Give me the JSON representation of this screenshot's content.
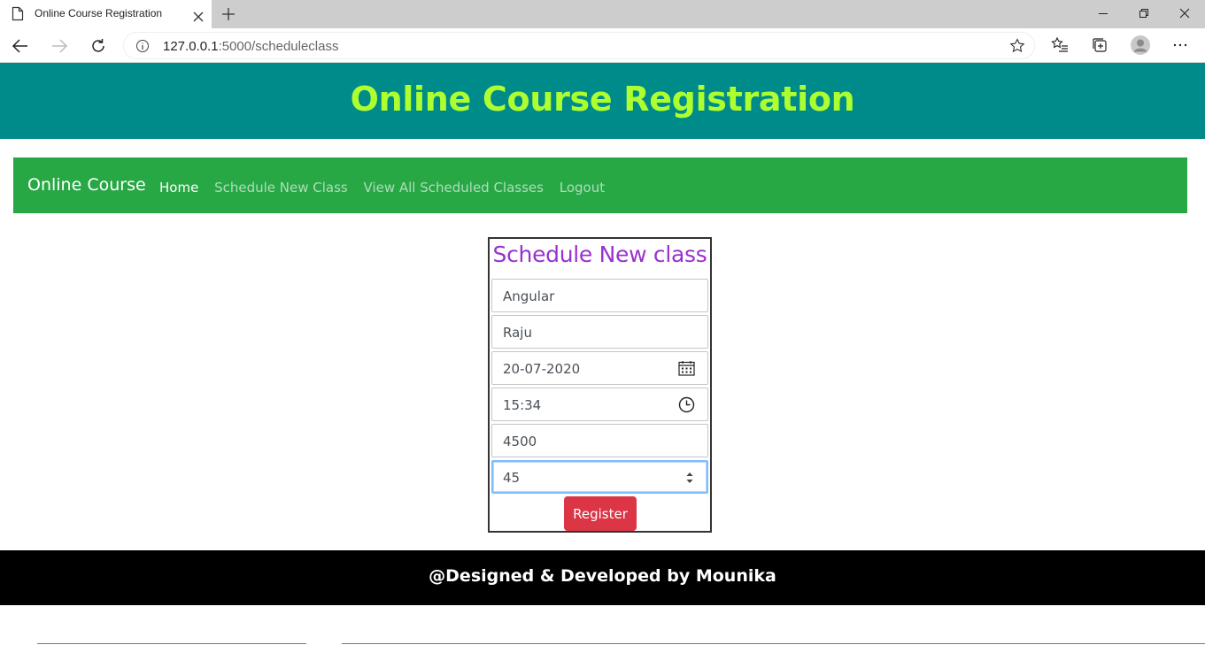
{
  "browser": {
    "tab_title": "Online Course Registration",
    "url_host": "127.0.0.1",
    "url_path": ":5000/scheduleclass"
  },
  "header": {
    "title": "Online Course Registration"
  },
  "navbar": {
    "brand": "Online Course",
    "links": [
      "Home",
      "Schedule New Class",
      "View All Scheduled Classes",
      "Logout"
    ],
    "active_link": "Home"
  },
  "form": {
    "title": "Schedule New class",
    "course": "Angular",
    "faculty": "Raju",
    "date": "20-07-2020",
    "time": "15:34",
    "fee": "4500",
    "duration": "45",
    "submit_label": "Register"
  },
  "footer": {
    "text": "@Designed & Developed by Mounika"
  },
  "colors": {
    "header_bg": "#008b8b",
    "header_text": "#adff2f",
    "navbar_bg": "#28a745",
    "form_title": "#9932cc",
    "button_bg": "#dc3545",
    "footer_bg": "#000000"
  },
  "icons": [
    "page-icon",
    "close-icon",
    "plus-icon",
    "minimize-icon",
    "restore-icon",
    "close-window-icon",
    "back-icon",
    "forward-icon",
    "refresh-icon",
    "info-icon",
    "star-icon",
    "favorites-icon",
    "collections-icon",
    "profile-icon",
    "more-icon",
    "calendar-icon",
    "clock-icon",
    "spinner-icon"
  ]
}
